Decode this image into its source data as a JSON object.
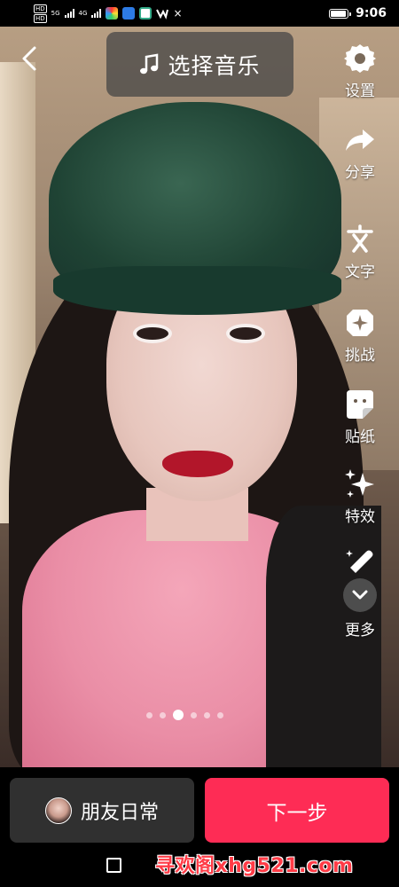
{
  "status_bar": {
    "hd1": "HD",
    "hd2": "HD",
    "net_label": "5G",
    "net_label2": "4G",
    "notif_x": "×",
    "battery_pct": 0.92,
    "time": "9:06"
  },
  "top_bar": {
    "music_label": "选择音乐"
  },
  "tools": [
    {
      "icon": "settings-icon",
      "label": "设置"
    },
    {
      "icon": "share-icon",
      "label": "分享"
    },
    {
      "icon": "text-icon",
      "label": "文字"
    },
    {
      "icon": "challenge-icon",
      "label": "挑战"
    },
    {
      "icon": "sticker-icon",
      "label": "贴纸"
    },
    {
      "icon": "effects-icon",
      "label": "特效"
    },
    {
      "icon": "more-icon",
      "label": "更多"
    }
  ],
  "carousel": {
    "count": 6,
    "active_index": 2
  },
  "bottom": {
    "friends_label": "朋友日常",
    "next_label": "下一步"
  },
  "watermark": "寻欢阁xhg521.com",
  "colors": {
    "accent": "#fe2c55",
    "button_dark": "#303030"
  }
}
